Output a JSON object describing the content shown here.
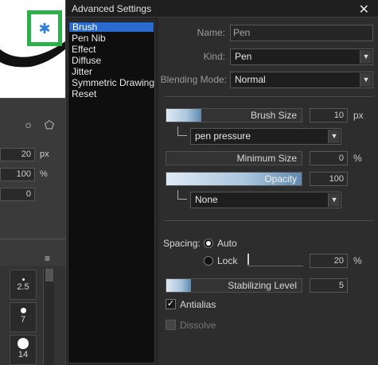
{
  "left_panel": {
    "fields": [
      {
        "value": "20",
        "unit": "px"
      },
      {
        "value": "100",
        "unit": "%"
      },
      {
        "value": "0",
        "unit": ""
      }
    ],
    "brush_sizes": [
      "2.5",
      "7",
      "14"
    ],
    "menu_glyph": "≡",
    "gear_icon": "✱",
    "shape_icons": [
      "○",
      "⬠"
    ]
  },
  "window": {
    "title": "Advanced Settings",
    "close_glyph": "✕",
    "categories": [
      "Brush",
      "Pen Nib",
      "Effect",
      "Diffuse",
      "Jitter",
      "Symmetric Drawing",
      "Reset"
    ],
    "selected_category": "Brush"
  },
  "settings": {
    "name_label": "Name:",
    "name_value": "Pen",
    "kind_label": "Kind:",
    "kind_value": "Pen",
    "blending_label": "Blending Mode:",
    "blending_value": "Normal",
    "brush_size": {
      "label": "Brush Size",
      "value": "10",
      "unit": "px",
      "fill_fraction": 0.26,
      "input": "pen pressure"
    },
    "minimum_size": {
      "label": "Minimum Size",
      "value": "0",
      "unit": "%"
    },
    "opacity": {
      "label": "Opacity",
      "value": "100",
      "fill_fraction": 1.0,
      "input": "None"
    },
    "spacing": {
      "label": "Spacing:",
      "auto_label": "Auto",
      "lock_label": "Lock",
      "selected": "Auto",
      "value": "20",
      "unit": "%"
    },
    "stabilizing": {
      "label": "Stabilizing Level",
      "value": "5",
      "fill_fraction": 0.18
    },
    "antialias": {
      "label": "Antialias",
      "checked": true
    },
    "dissolve": {
      "label": "Dissolve",
      "checked": false,
      "enabled": false
    }
  },
  "colors": {
    "selection": "#2a6bd0",
    "highlight_box": "#2bb04a",
    "gear": "#2f7fd8"
  }
}
